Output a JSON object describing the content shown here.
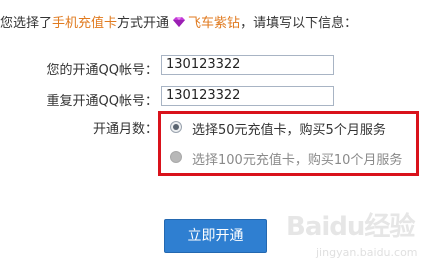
{
  "intro": {
    "prefix": "您选择了",
    "method": "手机充值卡",
    "middle": "方式开通",
    "service": "飞车紫钻",
    "suffix": "，请填写以下信息："
  },
  "form": {
    "qq_label": "您的开通QQ帐号：",
    "qq_value": "130123322",
    "qq_repeat_label": "重复开通QQ帐号：",
    "qq_repeat_value": "130123322",
    "months_label": "开通月数：",
    "options": [
      {
        "label": "选择50元充值卡，购买5个月服务",
        "selected": true
      },
      {
        "label": "选择100元充值卡，购买10个月服务",
        "selected": false
      }
    ],
    "submit_label": "立即开通"
  },
  "watermark": {
    "logo": "Baidu经验",
    "url": "jingyan.baidu.com"
  },
  "colors": {
    "accent_orange": "#e07a1f",
    "highlight_red": "#d9121b",
    "button_blue": "#2f7fd1"
  }
}
